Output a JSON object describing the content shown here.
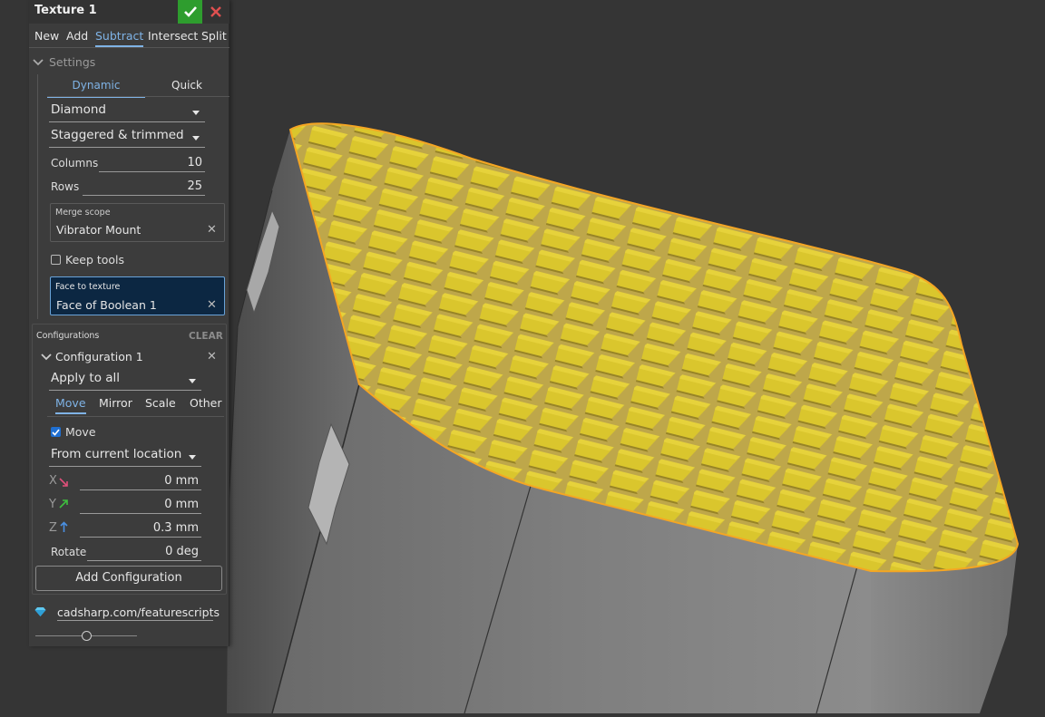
{
  "feature": {
    "title": "Texture 1",
    "ok_icon": "check-icon",
    "cancel_icon": "close-icon"
  },
  "operation_tabs": [
    {
      "label": "New",
      "active": false
    },
    {
      "label": "Add",
      "active": false
    },
    {
      "label": "Subtract",
      "active": true
    },
    {
      "label": "Intersect",
      "active": false
    },
    {
      "label": "Split",
      "active": false
    }
  ],
  "settings": {
    "label": "Settings",
    "tabs": [
      {
        "label": "Dynamic",
        "active": true
      },
      {
        "label": "Quick",
        "active": false
      }
    ],
    "pattern": "Diamond",
    "arrangement": "Staggered & trimmed",
    "columns": {
      "label": "Columns",
      "value": "10"
    },
    "rows": {
      "label": "Rows",
      "value": "25"
    },
    "merge_scope": {
      "label": "Merge scope",
      "value": "Vibrator Mount"
    },
    "keep_tools": {
      "label": "Keep tools",
      "checked": false
    },
    "face_to_texture": {
      "label": "Face to texture",
      "value": "Face of Boolean 1"
    }
  },
  "configurations": {
    "label": "Configurations",
    "clear_label": "CLEAR",
    "item": {
      "name": "Configuration 1",
      "apply_to": "Apply to all",
      "tabs": [
        {
          "label": "Move",
          "active": true
        },
        {
          "label": "Mirror",
          "active": false
        },
        {
          "label": "Scale",
          "active": false
        },
        {
          "label": "Other",
          "active": false
        }
      ],
      "move": {
        "label": "Move",
        "checked": true
      },
      "move_mode": "From current location",
      "x": {
        "label": "X",
        "value": "0 mm",
        "color": "#e0507a"
      },
      "y": {
        "label": "Y",
        "value": "0 mm",
        "color": "#3fbf3f"
      },
      "z": {
        "label": "Z",
        "value": "0.3 mm",
        "color": "#4a90e2"
      },
      "rotate": {
        "label": "Rotate",
        "value": "0 deg"
      }
    },
    "add_label": "Add Configuration"
  },
  "footer": {
    "icon": "diamond-icon",
    "link": "cadsharp.com/featurescripts",
    "slider_value": 0.5
  },
  "colors": {
    "accent": "#7fb3e6",
    "confirm": "#2e9d2e",
    "cancel": "#e05050",
    "texture": "#c8b42a",
    "highlight_edge": "#f5a623"
  }
}
